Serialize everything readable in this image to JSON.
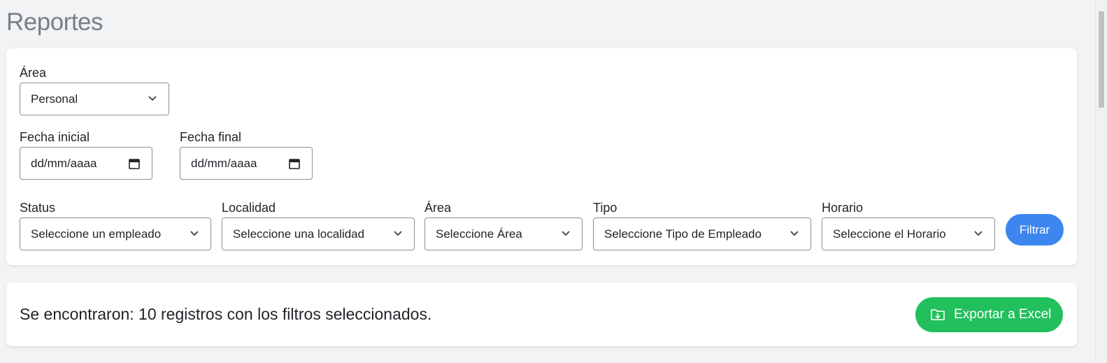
{
  "page": {
    "title": "Reportes"
  },
  "filters": {
    "area_top": {
      "label": "Área",
      "value": "Personal"
    },
    "fecha_inicial": {
      "label": "Fecha inicial",
      "value": "dd/mm/aaaa"
    },
    "fecha_final": {
      "label": "Fecha final",
      "value": "dd/mm/aaaa"
    },
    "status": {
      "label": "Status",
      "value": "Seleccione un empleado"
    },
    "localidad": {
      "label": "Localidad",
      "value": "Seleccione una localidad"
    },
    "area": {
      "label": "Área",
      "value": "Seleccione Área"
    },
    "tipo": {
      "label": "Tipo",
      "value": "Seleccione Tipo de Empleado"
    },
    "horario": {
      "label": "Horario",
      "value": "Seleccione el Horario"
    },
    "filter_button": "Filtrar"
  },
  "results": {
    "summary": "Se encontraron: 10 registros con los filtros seleccionados.",
    "export_button": "Exportar a Excel"
  },
  "icons": {
    "select": "chevron-down-icon",
    "date": "calendar-icon",
    "export": "folder-download-icon"
  },
  "colors": {
    "background": "#f1f3f4",
    "card": "#ffffff",
    "primary_button": "#3d86f0",
    "export_button": "#22c05d",
    "title": "#7a7f87"
  }
}
